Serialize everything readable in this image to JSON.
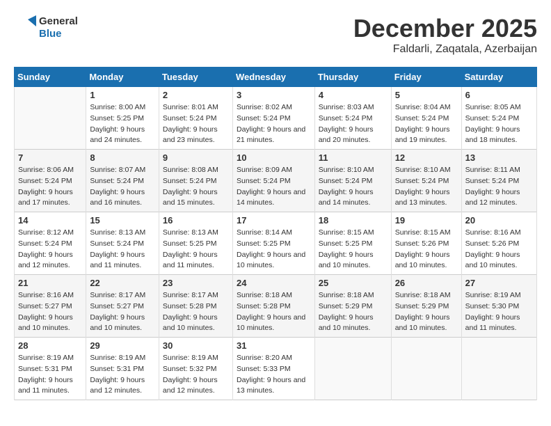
{
  "header": {
    "logo_general": "General",
    "logo_blue": "Blue",
    "month": "December 2025",
    "location": "Faldarli, Zaqatala, Azerbaijan"
  },
  "columns": [
    "Sunday",
    "Monday",
    "Tuesday",
    "Wednesday",
    "Thursday",
    "Friday",
    "Saturday"
  ],
  "weeks": [
    [
      {
        "day": "",
        "sunrise": "",
        "sunset": "",
        "daylight": ""
      },
      {
        "day": "1",
        "sunrise": "8:00 AM",
        "sunset": "5:25 PM",
        "daylight": "9 hours and 24 minutes."
      },
      {
        "day": "2",
        "sunrise": "8:01 AM",
        "sunset": "5:24 PM",
        "daylight": "9 hours and 23 minutes."
      },
      {
        "day": "3",
        "sunrise": "8:02 AM",
        "sunset": "5:24 PM",
        "daylight": "9 hours and 21 minutes."
      },
      {
        "day": "4",
        "sunrise": "8:03 AM",
        "sunset": "5:24 PM",
        "daylight": "9 hours and 20 minutes."
      },
      {
        "day": "5",
        "sunrise": "8:04 AM",
        "sunset": "5:24 PM",
        "daylight": "9 hours and 19 minutes."
      },
      {
        "day": "6",
        "sunrise": "8:05 AM",
        "sunset": "5:24 PM",
        "daylight": "9 hours and 18 minutes."
      }
    ],
    [
      {
        "day": "7",
        "sunrise": "8:06 AM",
        "sunset": "5:24 PM",
        "daylight": "9 hours and 17 minutes."
      },
      {
        "day": "8",
        "sunrise": "8:07 AM",
        "sunset": "5:24 PM",
        "daylight": "9 hours and 16 minutes."
      },
      {
        "day": "9",
        "sunrise": "8:08 AM",
        "sunset": "5:24 PM",
        "daylight": "9 hours and 15 minutes."
      },
      {
        "day": "10",
        "sunrise": "8:09 AM",
        "sunset": "5:24 PM",
        "daylight": "9 hours and 14 minutes."
      },
      {
        "day": "11",
        "sunrise": "8:10 AM",
        "sunset": "5:24 PM",
        "daylight": "9 hours and 14 minutes."
      },
      {
        "day": "12",
        "sunrise": "8:10 AM",
        "sunset": "5:24 PM",
        "daylight": "9 hours and 13 minutes."
      },
      {
        "day": "13",
        "sunrise": "8:11 AM",
        "sunset": "5:24 PM",
        "daylight": "9 hours and 12 minutes."
      }
    ],
    [
      {
        "day": "14",
        "sunrise": "8:12 AM",
        "sunset": "5:24 PM",
        "daylight": "9 hours and 12 minutes."
      },
      {
        "day": "15",
        "sunrise": "8:13 AM",
        "sunset": "5:24 PM",
        "daylight": "9 hours and 11 minutes."
      },
      {
        "day": "16",
        "sunrise": "8:13 AM",
        "sunset": "5:25 PM",
        "daylight": "9 hours and 11 minutes."
      },
      {
        "day": "17",
        "sunrise": "8:14 AM",
        "sunset": "5:25 PM",
        "daylight": "9 hours and 10 minutes."
      },
      {
        "day": "18",
        "sunrise": "8:15 AM",
        "sunset": "5:25 PM",
        "daylight": "9 hours and 10 minutes."
      },
      {
        "day": "19",
        "sunrise": "8:15 AM",
        "sunset": "5:26 PM",
        "daylight": "9 hours and 10 minutes."
      },
      {
        "day": "20",
        "sunrise": "8:16 AM",
        "sunset": "5:26 PM",
        "daylight": "9 hours and 10 minutes."
      }
    ],
    [
      {
        "day": "21",
        "sunrise": "8:16 AM",
        "sunset": "5:27 PM",
        "daylight": "9 hours and 10 minutes."
      },
      {
        "day": "22",
        "sunrise": "8:17 AM",
        "sunset": "5:27 PM",
        "daylight": "9 hours and 10 minutes."
      },
      {
        "day": "23",
        "sunrise": "8:17 AM",
        "sunset": "5:28 PM",
        "daylight": "9 hours and 10 minutes."
      },
      {
        "day": "24",
        "sunrise": "8:18 AM",
        "sunset": "5:28 PM",
        "daylight": "9 hours and 10 minutes."
      },
      {
        "day": "25",
        "sunrise": "8:18 AM",
        "sunset": "5:29 PM",
        "daylight": "9 hours and 10 minutes."
      },
      {
        "day": "26",
        "sunrise": "8:18 AM",
        "sunset": "5:29 PM",
        "daylight": "9 hours and 10 minutes."
      },
      {
        "day": "27",
        "sunrise": "8:19 AM",
        "sunset": "5:30 PM",
        "daylight": "9 hours and 11 minutes."
      }
    ],
    [
      {
        "day": "28",
        "sunrise": "8:19 AM",
        "sunset": "5:31 PM",
        "daylight": "9 hours and 11 minutes."
      },
      {
        "day": "29",
        "sunrise": "8:19 AM",
        "sunset": "5:31 PM",
        "daylight": "9 hours and 12 minutes."
      },
      {
        "day": "30",
        "sunrise": "8:19 AM",
        "sunset": "5:32 PM",
        "daylight": "9 hours and 12 minutes."
      },
      {
        "day": "31",
        "sunrise": "8:20 AM",
        "sunset": "5:33 PM",
        "daylight": "9 hours and 13 minutes."
      },
      {
        "day": "",
        "sunrise": "",
        "sunset": "",
        "daylight": ""
      },
      {
        "day": "",
        "sunrise": "",
        "sunset": "",
        "daylight": ""
      },
      {
        "day": "",
        "sunrise": "",
        "sunset": "",
        "daylight": ""
      }
    ]
  ]
}
